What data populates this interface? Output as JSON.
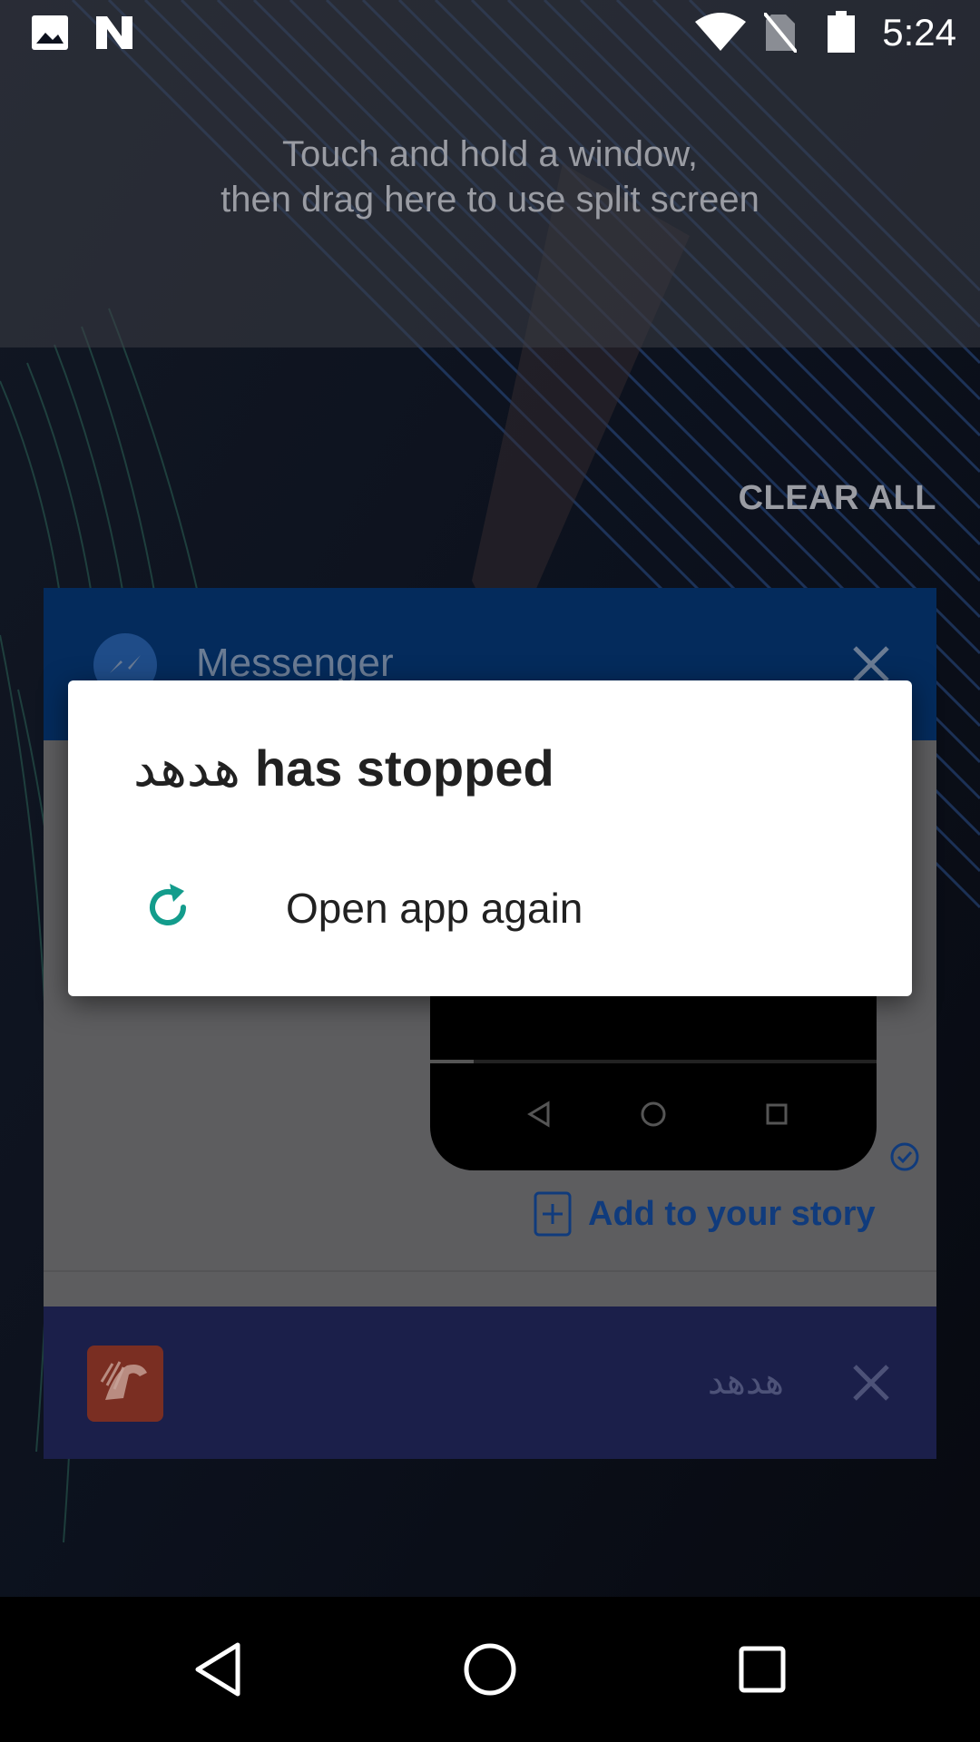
{
  "status_bar": {
    "time": "5:24",
    "icons": [
      "image-notification-icon",
      "n-notification-icon",
      "wifi-icon",
      "no-sim-icon",
      "battery-icon"
    ]
  },
  "split_screen": {
    "hint_line1": "Touch and hold a window,",
    "hint_line2": "then drag here to use split screen"
  },
  "recents": {
    "clear_all": "CLEAR ALL",
    "cards": [
      {
        "title": "Messenger",
        "accent": "#042b5c",
        "story_label": "Add to your story"
      },
      {
        "title": "هدهد",
        "accent": "#1b1f4a"
      }
    ]
  },
  "dialog": {
    "app_name": "هدهد",
    "title_suffix": "has stopped",
    "option_label": "Open app again",
    "option_icon": "reload-icon",
    "accent": "#139c8c"
  },
  "nav_bar": {
    "buttons": [
      "back-icon",
      "home-icon",
      "recents-icon"
    ]
  }
}
